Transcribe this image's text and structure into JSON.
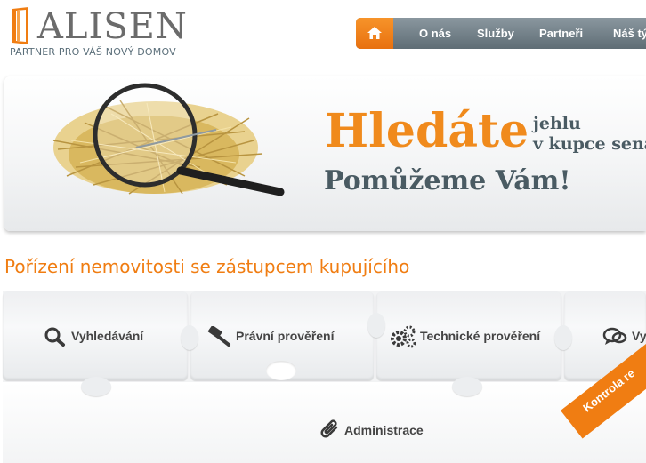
{
  "brand": {
    "name": "ALISEN",
    "tagline": "PARTNER PRO VÁŠ NOVÝ DOMOV"
  },
  "nav": {
    "home_icon": "home-icon",
    "items": [
      "O nás",
      "Služby",
      "Partneři",
      "Náš tý"
    ]
  },
  "banner": {
    "headline": "Hledáte",
    "line1": "jehlu",
    "line2": "v kupce sena",
    "subhead": "Pomůžeme Vám!"
  },
  "section": {
    "title": "Pořízení nemovitosti se zástupcem kupujícího",
    "tabs": [
      {
        "label": "Vyhledávání",
        "icon": "search-icon"
      },
      {
        "label": "Právní prověření",
        "icon": "gavel-icon"
      },
      {
        "label": "Technické prověření",
        "icon": "gears-icon"
      },
      {
        "label": "Vy",
        "icon": "chat-icon"
      },
      {
        "label": "Administrace",
        "icon": "paperclip-icon"
      }
    ],
    "ribbon": "Kontrola re"
  },
  "colors": {
    "accent": "#f07d12",
    "nav": "#6f7d85",
    "text_dark": "#4a5b63"
  }
}
